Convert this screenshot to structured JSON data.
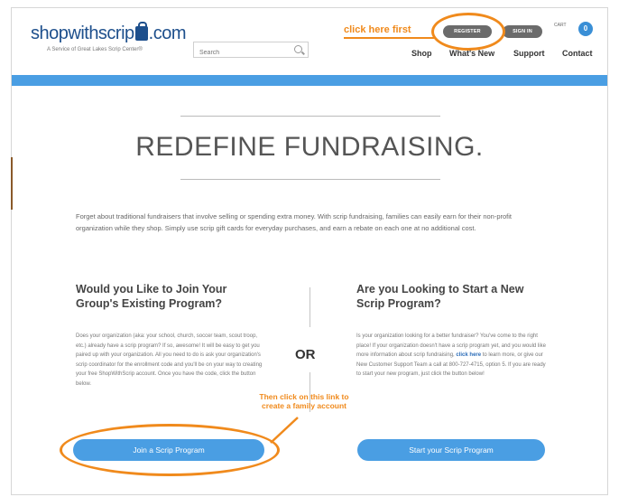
{
  "header": {
    "logo_left": "shopwithscrip",
    "logo_right": ".com",
    "tagline": "A Service of Great Lakes Scrip Center®",
    "search_placeholder": "Search",
    "register_label": "REGISTER",
    "signin_label": "SIGN IN",
    "cart_label": "CART",
    "cart_count": "0",
    "nav": [
      "Shop",
      "What's New",
      "Support",
      "Contact"
    ]
  },
  "annotations": {
    "click_first": "click here first",
    "then_click": "Then click on this link to create a family account"
  },
  "hero": {
    "title": "REDEFINE FUNDRAISING.",
    "intro": "Forget about traditional fundraisers that involve selling or spending extra money. With scrip fundraising, families can easily earn for their non-profit organization while they shop. Simply use scrip gift cards for everyday purchases, and earn a rebate on each one at no additional cost."
  },
  "left_column": {
    "title": "Would you Like to Join Your Group's Existing Program?",
    "body": "Does your organization (aka: your school, church, soccer team, scout troop, etc.) already have a scrip program? If so, awesome! It will be easy to get you paired up with your organization. All you need to do is ask your organization's scrip coordinator for the enrollment code and you'll be on your way to creating your free ShopWithScrip account. Once you have the code, click the button below.",
    "button_label": "Join a Scrip Program"
  },
  "divider": {
    "or_label": "OR"
  },
  "right_column": {
    "title": "Are you Looking to Start a New Scrip Program?",
    "body_before_link": "Is your organization looking for a better fundraiser? You've come to the right place! If your organization doesn't have a scrip program yet, and you would like more information about scrip fundraising, ",
    "link_label": "click here",
    "body_after_link": " to learn more, or give our New Customer Support Team a call at 800-727-4715, option 5. If you are ready to start your new program, just click the button below!",
    "button_label": "Start your Scrip Program"
  },
  "colors": {
    "brand_blue": "#1d4f8c",
    "accent_blue": "#4a9ee3",
    "annotation_orange": "#f08a1c",
    "pill_gray": "#6b6b6b"
  }
}
